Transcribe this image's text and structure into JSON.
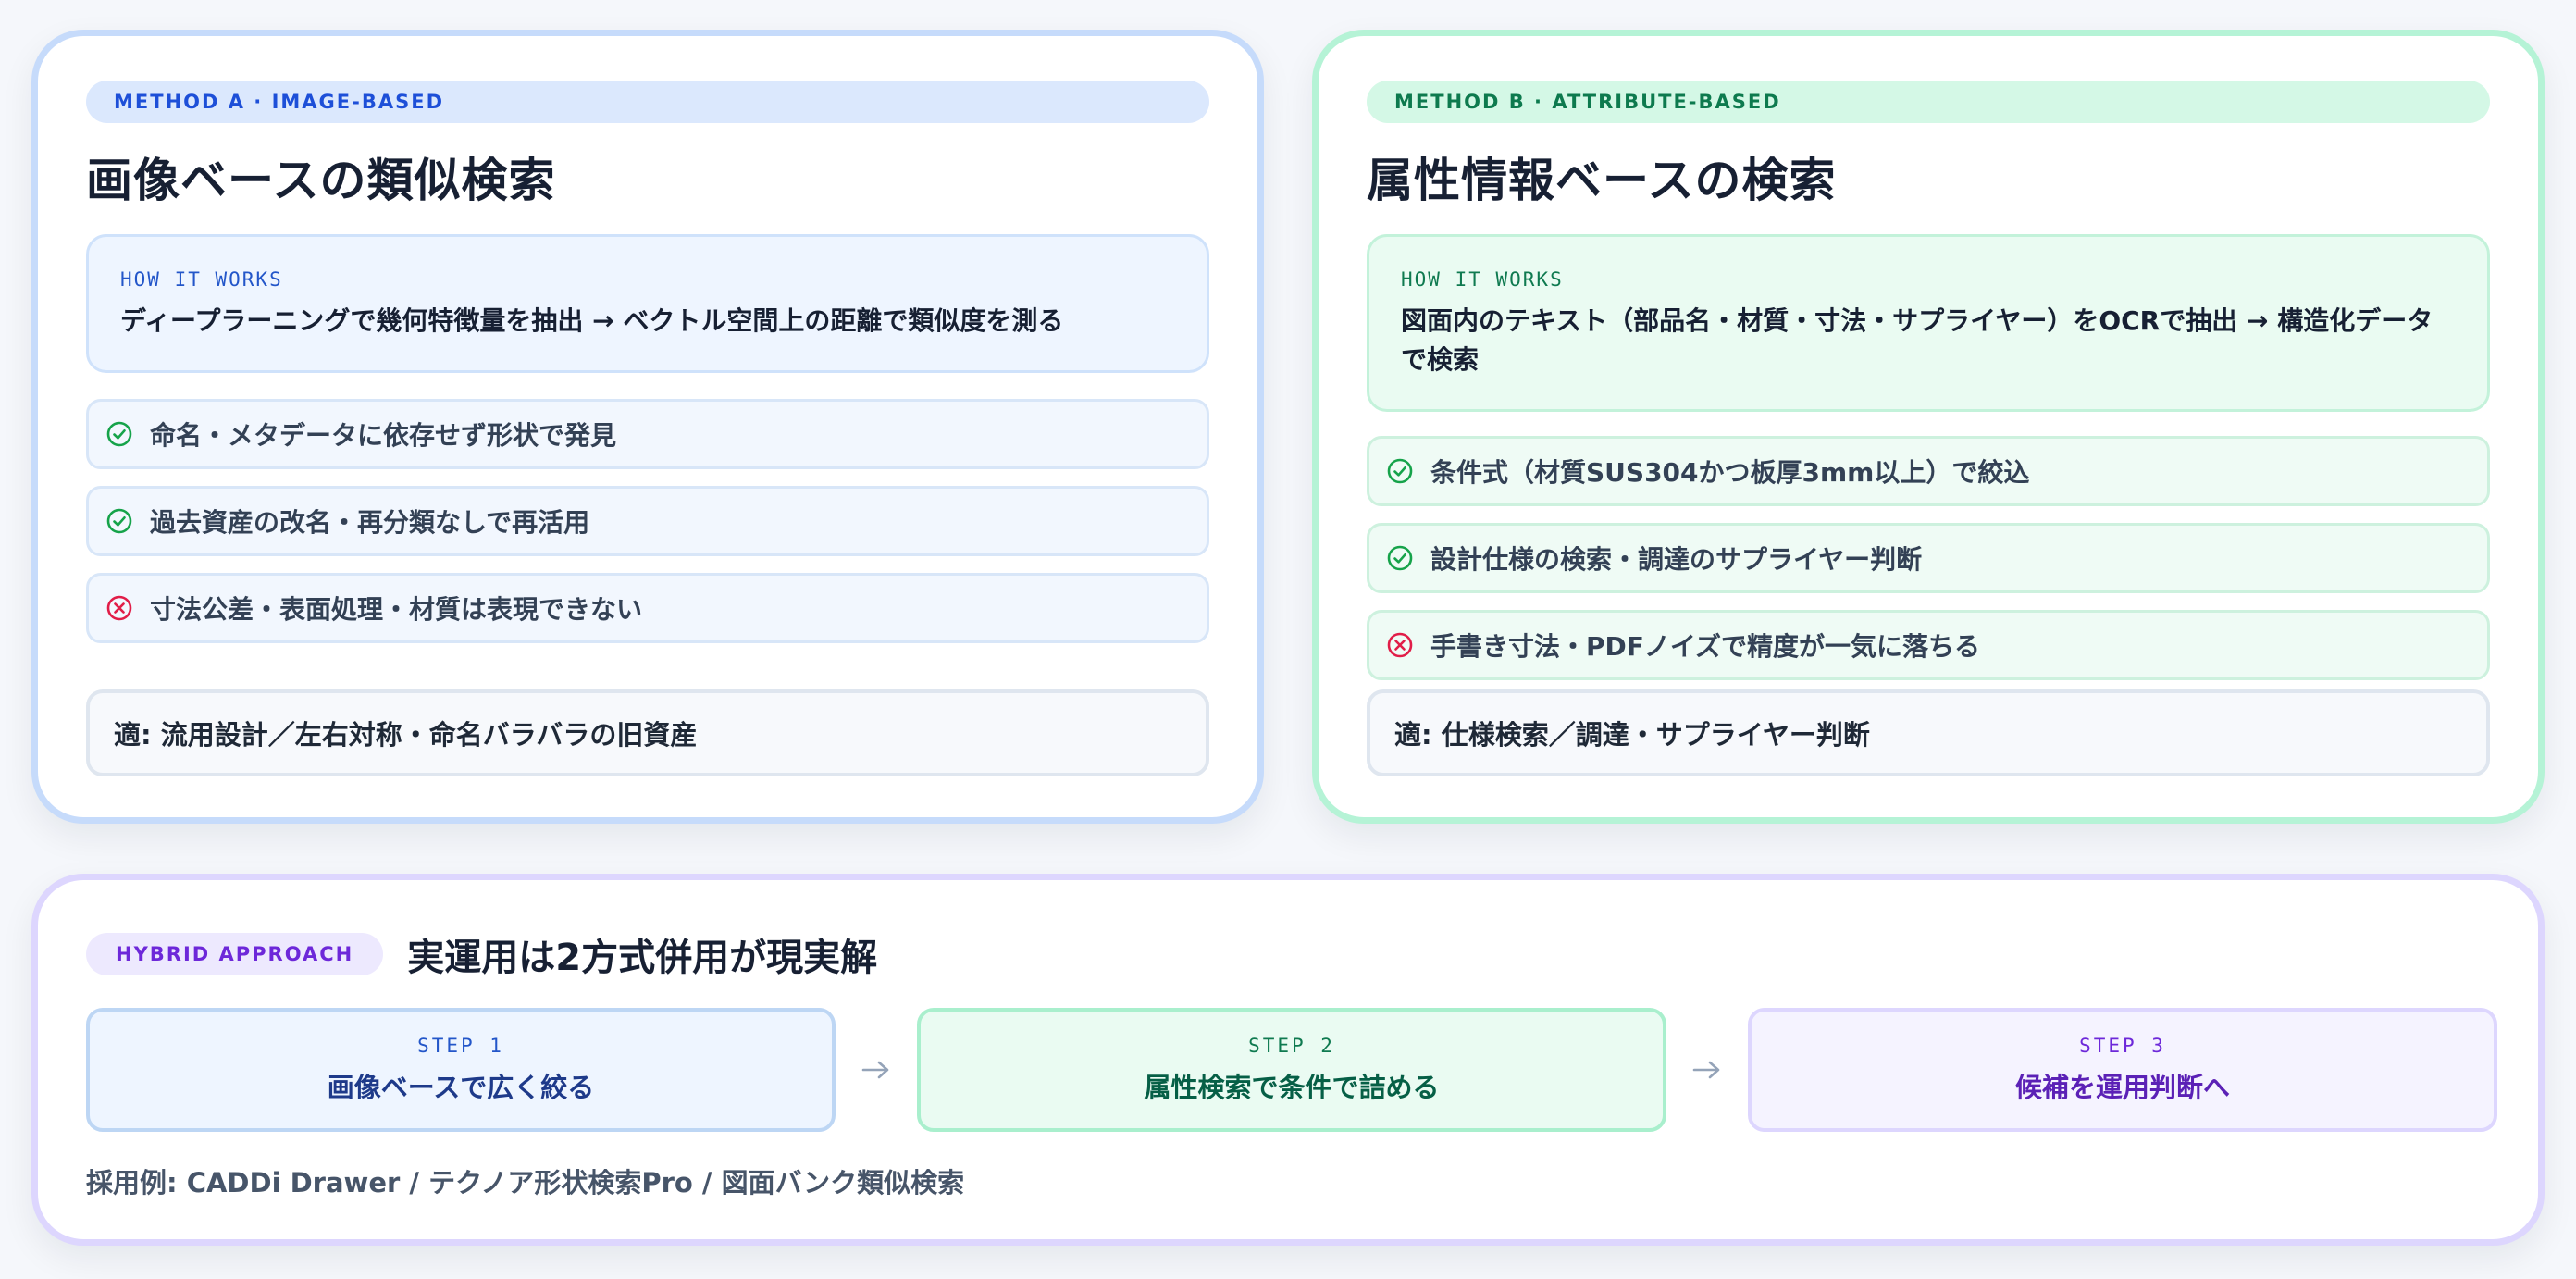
{
  "method_a": {
    "tag": "METHOD A · IMAGE-BASED",
    "title": "画像ベースの類似検索",
    "how_label": "HOW IT WORKS",
    "how_text": "ディープラーニングで幾何特徴量を抽出 → ベクトル空間上の距離で類似度を測る",
    "features": [
      {
        "icon": "check-circle-icon",
        "text": "命名・メタデータに依存せず形状で発見"
      },
      {
        "icon": "check-circle-icon",
        "text": "過去資産の改名・再分類なしで再活用"
      },
      {
        "icon": "x-circle-icon",
        "text": "寸法公差・表面処理・材質は表現できない"
      }
    ],
    "suitable": "適: 流用設計／左右対称・命名バラバラの旧資産"
  },
  "method_b": {
    "tag": "METHOD B · ATTRIBUTE-BASED",
    "title": "属性情報ベースの検索",
    "how_label": "HOW IT WORKS",
    "how_text": "図面内のテキスト（部品名・材質・寸法・サプライヤー）をOCRで抽出 → 構造化データで検索",
    "features": [
      {
        "icon": "check-circle-icon",
        "text": "条件式（材質SUS304かつ板厚3mm以上）で絞込"
      },
      {
        "icon": "check-circle-icon",
        "text": "設計仕様の検索・調達のサプライヤー判断"
      },
      {
        "icon": "x-circle-icon",
        "text": "手書き寸法・PDFノイズで精度が一気に落ちる"
      }
    ],
    "suitable": "適: 仕様検索／調達・サプライヤー判断"
  },
  "hybrid": {
    "tag": "HYBRID APPROACH",
    "title": "実運用は2方式併用が現実解",
    "steps": [
      {
        "label": "STEP 1",
        "text": "画像ベースで広く絞る"
      },
      {
        "label": "STEP 2",
        "text": "属性検索で条件で詰める"
      },
      {
        "label": "STEP 3",
        "text": "候補を運用判断へ"
      }
    ],
    "examples": "採用例: CADDi Drawer / テクノア形状検索Pro / 図面バンク類似検索"
  },
  "colors": {
    "check": "#16a34a",
    "cross": "#e11d48",
    "blue_accent": "#1d4fd8",
    "green_accent": "#0d7a4e",
    "purple_accent": "#6d28d9"
  }
}
